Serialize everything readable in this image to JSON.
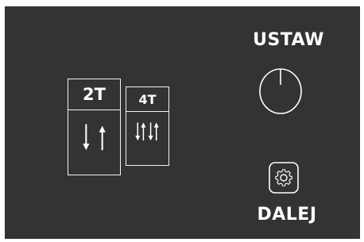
{
  "modes": {
    "two_stroke": {
      "label": "2T"
    },
    "four_stroke": {
      "label": "4T"
    }
  },
  "controls": {
    "set_label": "USTAW",
    "next_label": "DALEJ"
  },
  "icons": {
    "knob": "dial-knob-icon",
    "gear": "gear-icon",
    "two_stroke_arrows": "arrows-down-up-icon",
    "four_stroke_arrows": "arrows-double-down-up-icon"
  },
  "colors": {
    "screen_background": "#333333",
    "foreground": "#ffffff"
  }
}
